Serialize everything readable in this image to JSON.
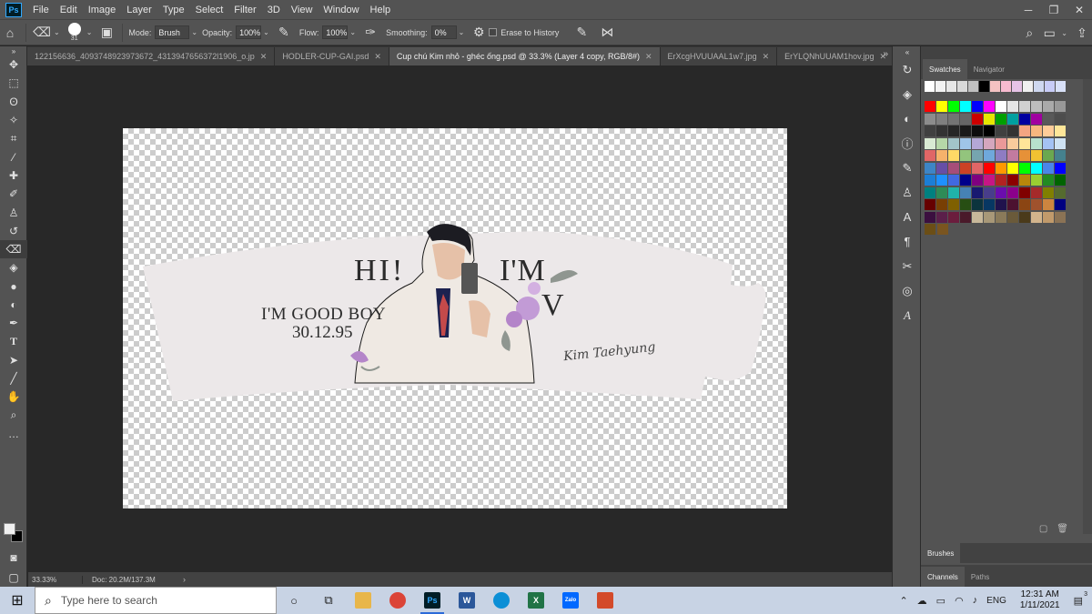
{
  "menubar": {
    "app_logo": "Ps",
    "items": [
      "File",
      "Edit",
      "Image",
      "Layer",
      "Type",
      "Select",
      "Filter",
      "3D",
      "View",
      "Window",
      "Help"
    ],
    "window_controls": [
      "minimize-icon",
      "restore-icon",
      "close-icon"
    ]
  },
  "options": {
    "brush_size": "31",
    "mode_label": "Mode:",
    "mode_value": "Brush",
    "opacity_label": "Opacity:",
    "opacity_value": "100%",
    "flow_label": "Flow:",
    "flow_value": "100%",
    "smoothing_label": "Smoothing:",
    "smoothing_value": "0%",
    "erase_history_label": "Erase to History"
  },
  "tabs": [
    {
      "label": "122156636_4093748923973672_4313947656372l1906_o.jp",
      "active": false
    },
    {
      "label": "HODLER-CUP-GAI.psd",
      "active": false
    },
    {
      "label": "Cup chú Kim nhỏ - ghéc ống.psd @ 33.3% (Layer 4 copy, RGB/8#)",
      "active": true
    },
    {
      "label": "ErXcgHVUUAAL1w7.jpg",
      "active": false
    },
    {
      "label": "ErYLQNhUUAM1hov.jpg",
      "active": false
    }
  ],
  "tabs_more": "»",
  "cup": {
    "hi": "HI!",
    "im": "I'M",
    "v": "V",
    "good_boy": "I'M GOOD BOY",
    "date": "30.12.95",
    "signature": "Kim Taehyung"
  },
  "status": {
    "zoom": "33.33%",
    "doc": "Doc: 20.2M/137.3M",
    "arrow": "›"
  },
  "panel": {
    "tab_swatches": "Swatches",
    "tab_navigator": "Navigator",
    "tab_brushes": "Brushes",
    "tab_channels": "Channels",
    "tab_paths": "Paths"
  },
  "swatches": [
    [
      "#ffffff",
      "#f2f2f2",
      "#e6e6e6",
      "#d9d9d9",
      "#c0c0c0",
      "#000000",
      "#f4c2c2",
      "#f8bbd0",
      "#e6c3e6",
      "#f0f0f0",
      "#cfd8f0",
      "#c8ccf7",
      "#d8e0f8"
    ],
    [
      "#ff0000",
      "#ffff00",
      "#00ff00",
      "#00ffff",
      "#0000ff",
      "#ff00ff",
      "#ffffff",
      "#e6e6e6",
      "#d0d0d0",
      "#bdbdbd",
      "#aaaaaa",
      "#999999"
    ],
    [
      "#8c8c8c",
      "#7f7f7f",
      "#737373",
      "#666666",
      "#cc0000",
      "#e6e600",
      "#00a000",
      "#00a0a0",
      "#0000a0",
      "#a000a0",
      "#595959",
      "#4d4d4d"
    ],
    [
      "#404040",
      "#333333",
      "#262626",
      "#1a1a1a",
      "#0d0d0d",
      "#000000",
      "#404040",
      "#333333",
      "#f4a582",
      "#f7b77f",
      "#ffcc99",
      "#ffe699"
    ],
    [
      "#d9ead3",
      "#b6d7a8",
      "#a2c4c9",
      "#9fc5e8",
      "#b4a7d6",
      "#d5a6bd",
      "#ea9999",
      "#f9cb9c",
      "#ffe599",
      "#b7e1cd",
      "#a4c2f4",
      "#cfe2f3"
    ],
    [
      "#e06666",
      "#f6b26b",
      "#ffd966",
      "#93c47d",
      "#76a5af",
      "#6fa8dc",
      "#8e7cc3",
      "#c27ba0",
      "#e69138",
      "#f1c232",
      "#6aa84f",
      "#45818e"
    ],
    [
      "#3d85c6",
      "#674ea7",
      "#a64d79",
      "#cc4125",
      "#e06666",
      "#ff0000",
      "#ff9900",
      "#ffff00",
      "#00ff00",
      "#00ffff",
      "#4a86e8",
      "#0000ff"
    ],
    [
      "#1c7ed6",
      "#1e90ff",
      "#4169e1",
      "#00008b",
      "#800080",
      "#c71585",
      "#b22222",
      "#8b0000",
      "#b8860b",
      "#9acd32",
      "#228b22",
      "#006400"
    ],
    [
      "#008080",
      "#2e8b57",
      "#20b2aa",
      "#4682b4",
      "#191970",
      "#483d8b",
      "#6a0dad",
      "#8b008b",
      "#800000",
      "#a52a2a",
      "#808000",
      "#556b2f"
    ],
    [
      "#660000",
      "#783f04",
      "#7f6000",
      "#274e13",
      "#0c343d",
      "#073763",
      "#20124d",
      "#4c1130",
      "#8b4513",
      "#a0522d",
      "#cd853f",
      "#000080"
    ],
    [
      "#3b0f3f",
      "#5b1f4a",
      "#6b1d3d",
      "#4a1a2a",
      "#c8b89a",
      "#a89878",
      "#8a7a5a",
      "#6a5a3a",
      "#4a3a1a",
      "#d2b48c",
      "#c19a6b",
      "#8b7355"
    ],
    [
      "#6b4e16",
      "#7a5520"
    ]
  ],
  "taskbar": {
    "search_placeholder": "Type here to search",
    "lang": "ENG",
    "time": "12:31 AM",
    "date": "1/11/2021",
    "notif_count": "3"
  }
}
